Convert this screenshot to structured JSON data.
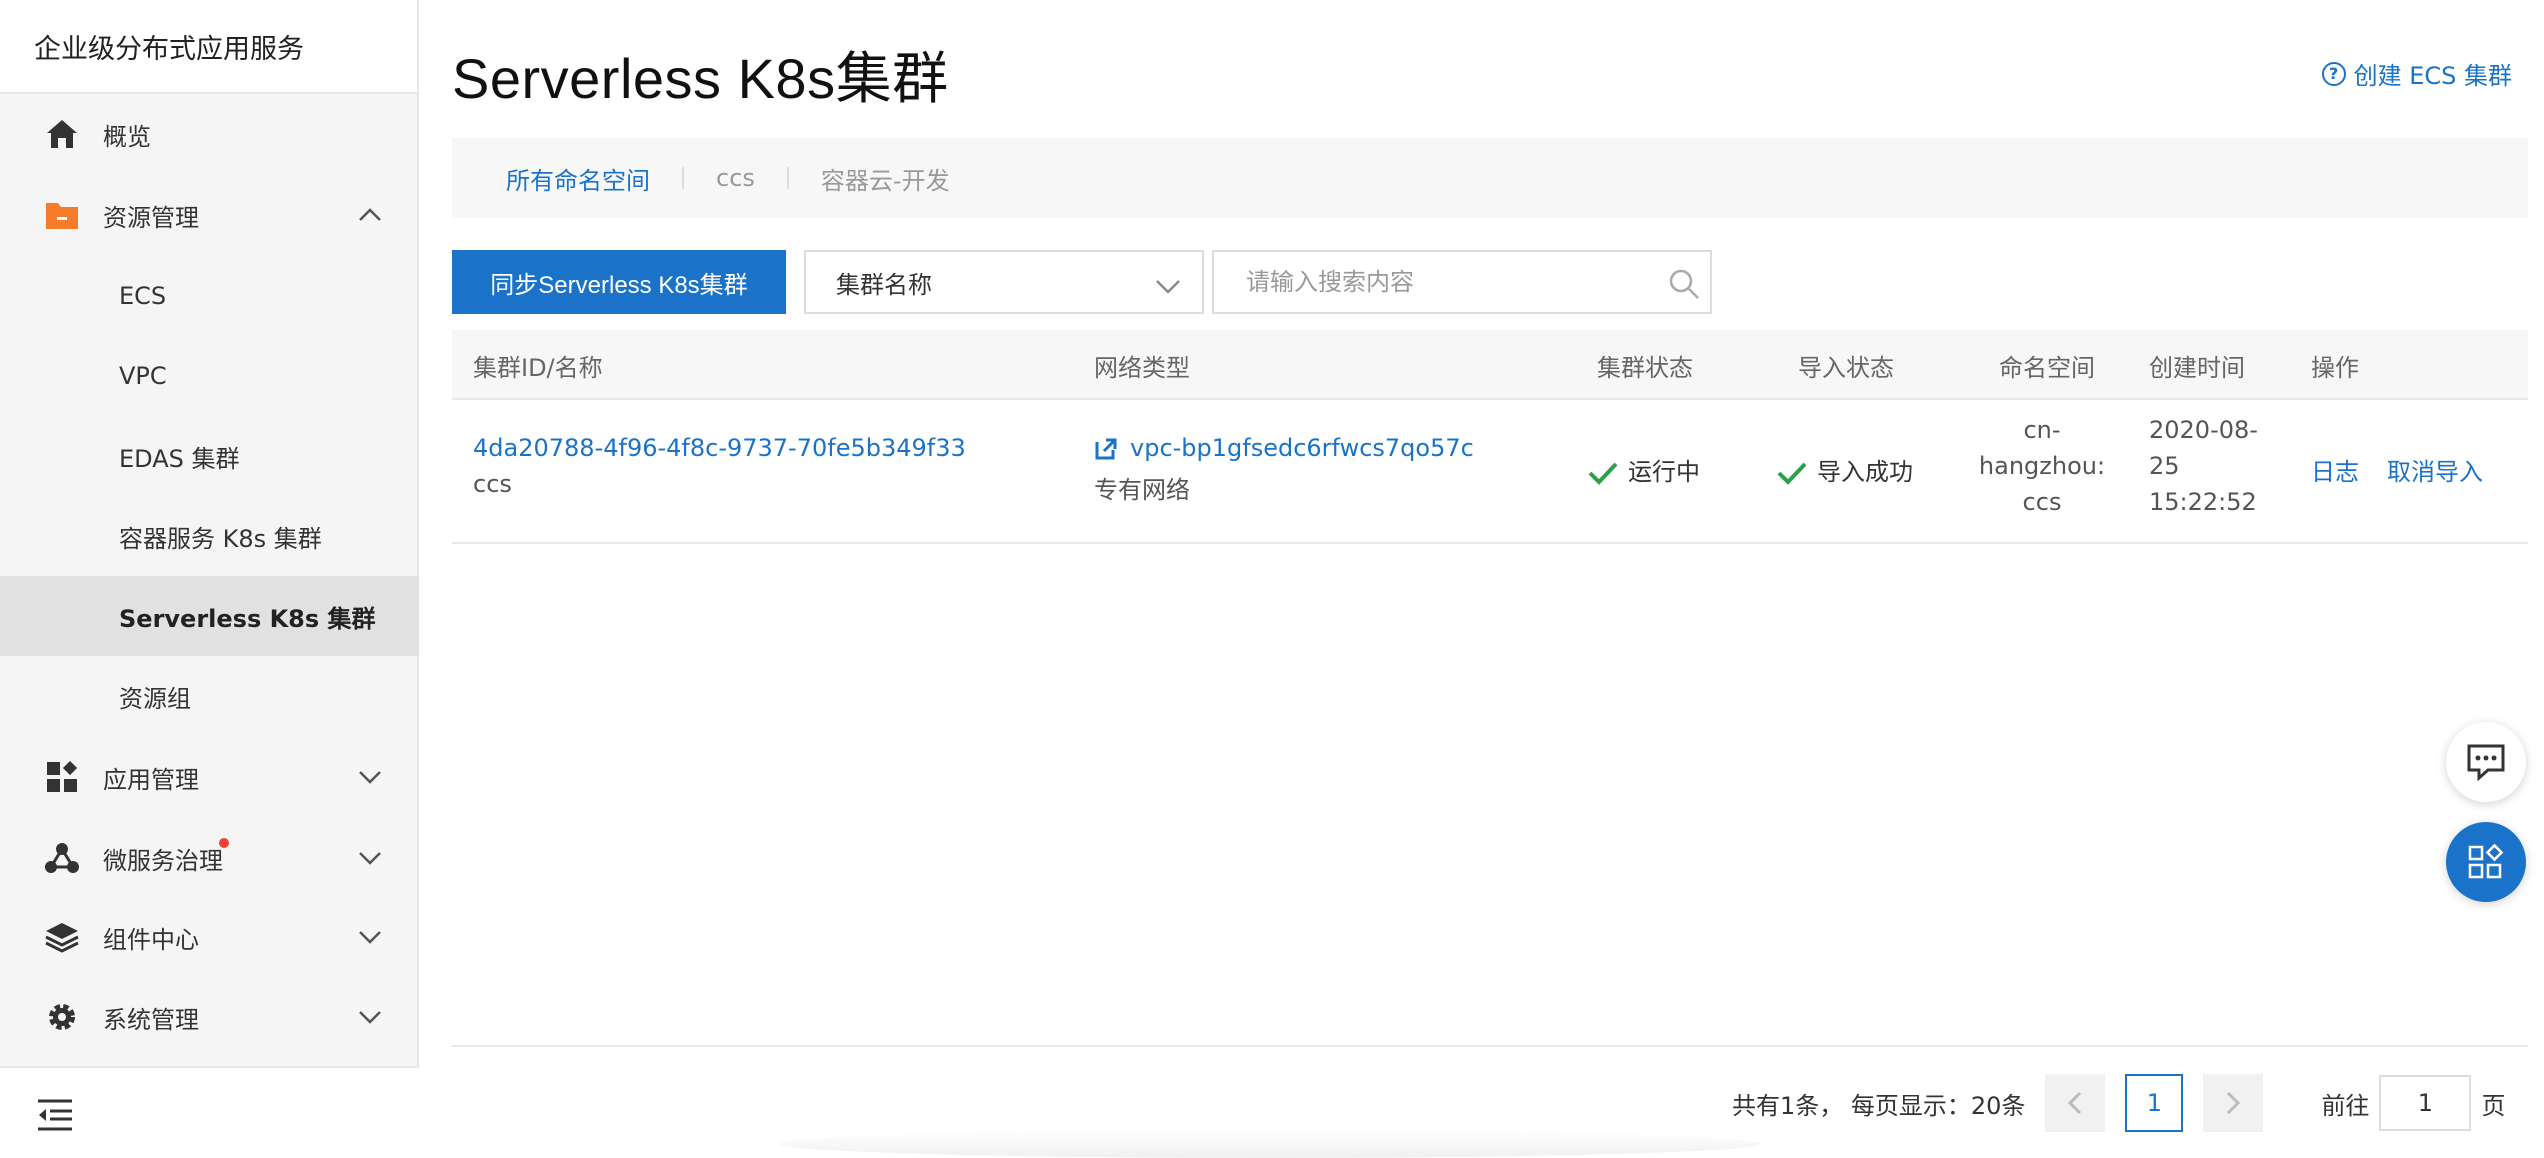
{
  "sidebar": {
    "brand": "企业级分布式应用服务",
    "items": [
      {
        "label": "概览",
        "icon": "home-icon"
      },
      {
        "label": "资源管理",
        "icon": "folder-icon"
      },
      {
        "label": "应用管理",
        "icon": "apps-icon"
      },
      {
        "label": "微服务治理",
        "icon": "microservice-icon"
      },
      {
        "label": "组件中心",
        "icon": "layers-icon"
      },
      {
        "label": "系统管理",
        "icon": "gear-icon"
      }
    ],
    "resource_sub": [
      "ECS",
      "VPC",
      "EDAS 集群",
      "容器服务 K8s 集群",
      "Serverless K8s 集群",
      "资源组"
    ],
    "active_sub": "Serverless K8s 集群"
  },
  "header": {
    "title": "Serverless K8s集群",
    "create_link": "创建 ECS 集群"
  },
  "namespaces": [
    "所有命名空间",
    "ccs",
    "容器云-开发"
  ],
  "toolbar": {
    "sync_button": "同步Serverless K8s集群",
    "select_value": "集群名称",
    "search_placeholder": "请输入搜索内容"
  },
  "table": {
    "columns": [
      "集群ID/名称",
      "网络类型",
      "集群状态",
      "导入状态",
      "命名空间",
      "创建时间",
      "操作"
    ],
    "rows": [
      {
        "cluster_id": "4da20788-4f96-4f8c-9737-70fe5b349f33",
        "cluster_name": "ccs",
        "vpc_id": "vpc-bp1gfsedc6rfwcs7qo57c",
        "network_type": "专有网络",
        "cluster_status": "运行中",
        "import_status": "导入成功",
        "namespace": [
          "cn-",
          "hangzhou:",
          "ccs"
        ],
        "created": [
          "2020-08-",
          "25",
          "15:22:52"
        ],
        "actions": [
          "日志",
          "取消导入"
        ]
      }
    ]
  },
  "pagination": {
    "summary": "共有1条， 每页显示：20条",
    "current_page": "1",
    "goto_label": "前往",
    "goto_value": "1",
    "page_suffix": "页"
  },
  "colors": {
    "accent": "#1a73c8",
    "success": "#2aa04a",
    "folder": "#f57c2b",
    "badge": "#f04134"
  }
}
